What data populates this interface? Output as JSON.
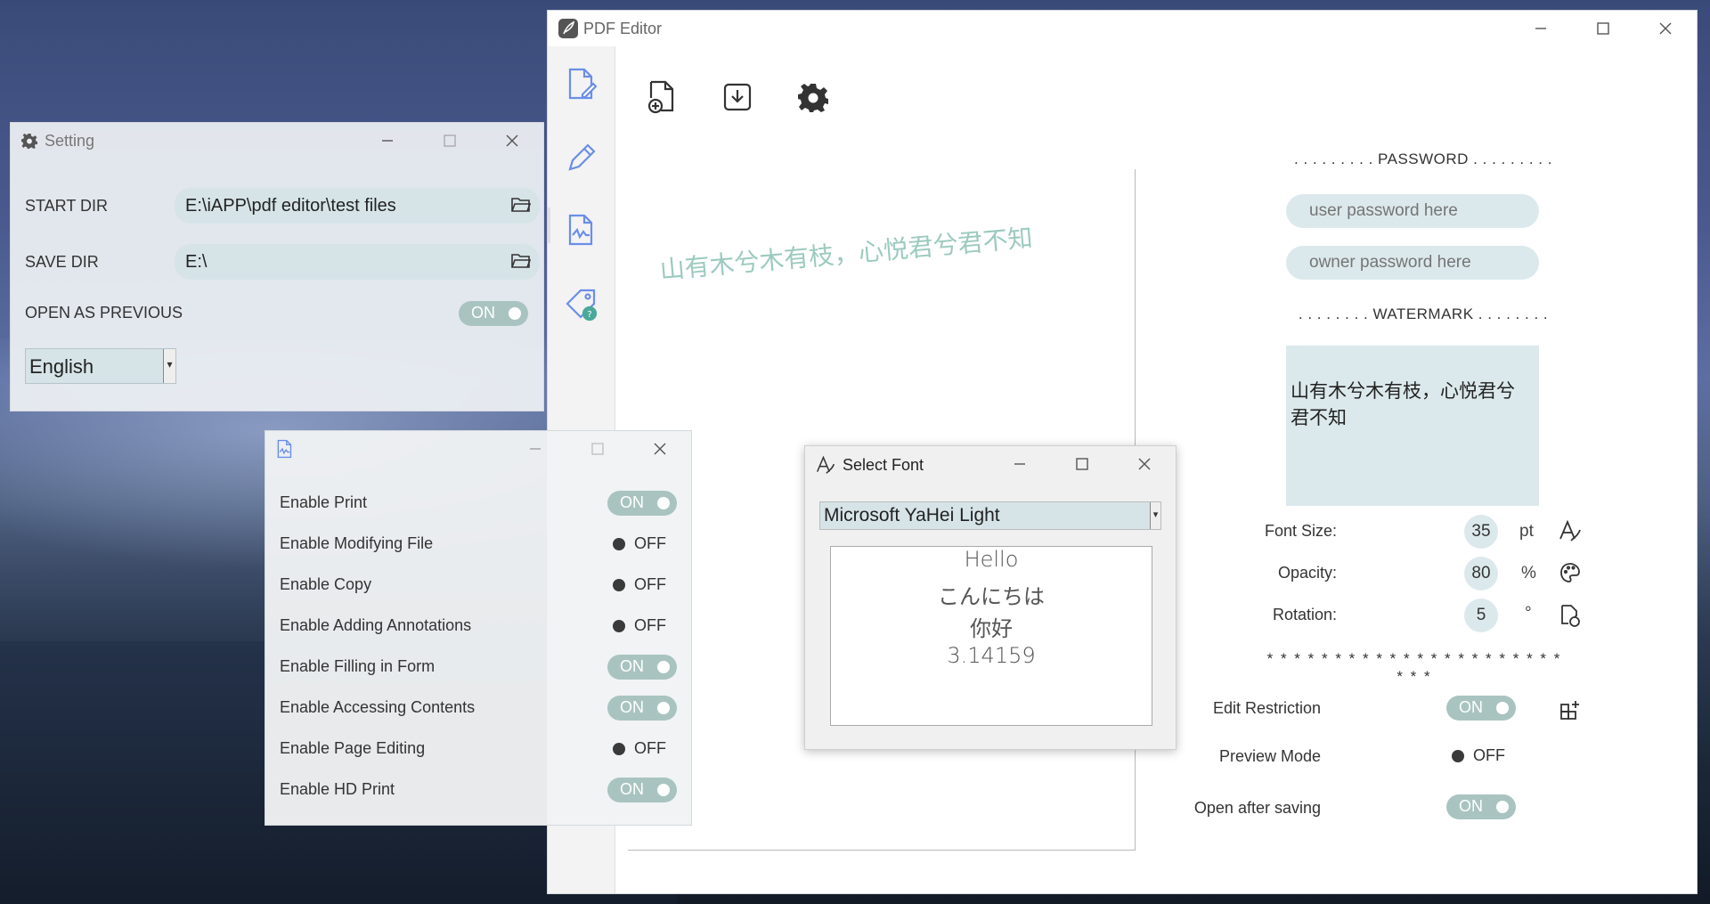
{
  "main_window": {
    "title": "PDF Editor",
    "sidebar": [
      "new-document-icon",
      "edit-pen-icon",
      "signature-document-icon",
      "tag-help-icon"
    ],
    "toolbar": [
      "add-file-icon",
      "save-download-icon",
      "gear-icon"
    ],
    "preview_watermark": "山有木兮木有枝，心悦君兮君不知",
    "password_section": {
      "heading": ". . . . . . . . . PASSWORD . . . . . . . . .",
      "user_placeholder": "user password here",
      "owner_placeholder": "owner password here"
    },
    "watermark_section": {
      "heading": ". . . . . . . . WATERMARK . . . . . . . .",
      "text_line1": "山有木兮木有枝，心悦君兮",
      "text_line2": "君不知",
      "font_size_label": "Font Size:",
      "font_size_value": "35",
      "font_size_unit": "pt",
      "opacity_label": "Opacity:",
      "opacity_value": "80",
      "opacity_unit": "%",
      "rotation_label": "Rotation:",
      "rotation_value": "5",
      "rotation_unit": "°"
    },
    "separator": "* * * * * * * * * * * * * * * * * * * * * * * * *",
    "options": {
      "edit_restriction_label": "Edit Restriction",
      "edit_restriction_state": "ON",
      "preview_mode_label": "Preview Mode",
      "preview_mode_state": "OFF",
      "open_after_saving_label": "Open after saving",
      "open_after_saving_state": "ON"
    }
  },
  "setting_window": {
    "title": "Setting",
    "start_dir_label": "START DIR",
    "start_dir_value": "E:\\iAPP\\pdf editor\\test files",
    "save_dir_label": "SAVE DIR",
    "save_dir_value": "E:\\",
    "open_as_previous_label": "OPEN AS PREVIOUS",
    "open_as_previous_state": "ON",
    "language": "English"
  },
  "permissions_window": {
    "items": [
      {
        "label": "Enable Print",
        "state": "ON"
      },
      {
        "label": "Enable Modifying File",
        "state": "OFF"
      },
      {
        "label": "Enable Copy",
        "state": "OFF"
      },
      {
        "label": "Enable Adding Annotations",
        "state": "OFF"
      },
      {
        "label": "Enable Filling in Form",
        "state": "ON"
      },
      {
        "label": "Enable Accessing Contents",
        "state": "ON"
      },
      {
        "label": "Enable Page Editing",
        "state": "OFF"
      },
      {
        "label": "Enable HD Print",
        "state": "ON"
      }
    ]
  },
  "font_window": {
    "title": "Select Font",
    "selected_font": "Microsoft YaHei Light",
    "preview_lines": [
      "Hello",
      "こんにちは",
      "你好",
      "3.14159"
    ]
  },
  "colors": {
    "accent_teal": "#a9c4c0",
    "field_bg": "#dce9ec",
    "watermark_text": "#9ccabf",
    "icon_blue": "#6b8ee8"
  }
}
